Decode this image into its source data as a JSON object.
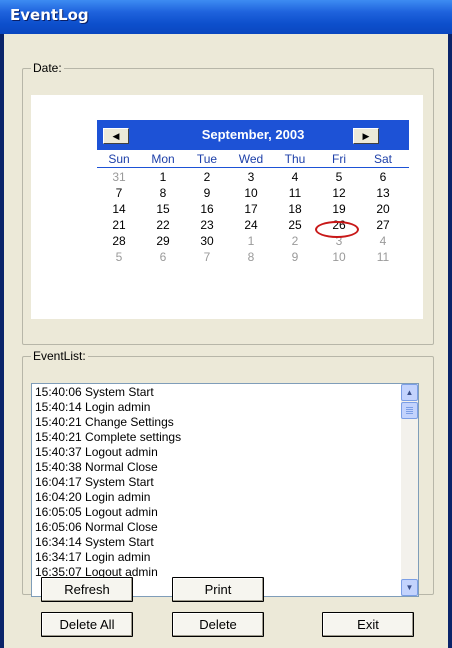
{
  "window": {
    "title": "EventLog"
  },
  "date_group": {
    "legend": "Date:"
  },
  "calendar": {
    "month_label": "September, 2003",
    "prev_glyph": "◀",
    "next_glyph": "▶",
    "weekdays": [
      "Sun",
      "Mon",
      "Tue",
      "Wed",
      "Thu",
      "Fri",
      "Sat"
    ],
    "weeks": [
      [
        "31",
        "1",
        "2",
        "3",
        "4",
        "5",
        "6"
      ],
      [
        "7",
        "8",
        "9",
        "10",
        "11",
        "12",
        "13"
      ],
      [
        "14",
        "15",
        "16",
        "17",
        "18",
        "19",
        "20"
      ],
      [
        "21",
        "22",
        "23",
        "24",
        "25",
        "26",
        "27"
      ],
      [
        "28",
        "29",
        "30",
        "1",
        "2",
        "3",
        "4"
      ],
      [
        "5",
        "6",
        "7",
        "8",
        "9",
        "10",
        "11"
      ]
    ],
    "selected_day": "5",
    "colors": {
      "header": "#1d52d6",
      "today_ring": "#c81818",
      "other_month": "#9a9a9a"
    }
  },
  "event_group": {
    "legend": "EventList:"
  },
  "events": [
    "15:40:06 System Start",
    "15:40:14 Login admin",
    "15:40:21 Change Settings",
    "15:40:21 Complete settings",
    "15:40:37 Logout admin",
    "15:40:38 Normal Close",
    "16:04:17 System Start",
    "16:04:20 Login admin",
    "16:05:05 Logout admin",
    "16:05:06 Normal Close",
    "16:34:14 System Start",
    "16:34:17 Login admin",
    "16:35:07 Logout admin"
  ],
  "buttons": {
    "refresh": "Refresh",
    "print": "Print",
    "delete_all": "Delete All",
    "delete": "Delete",
    "exit": "Exit"
  }
}
